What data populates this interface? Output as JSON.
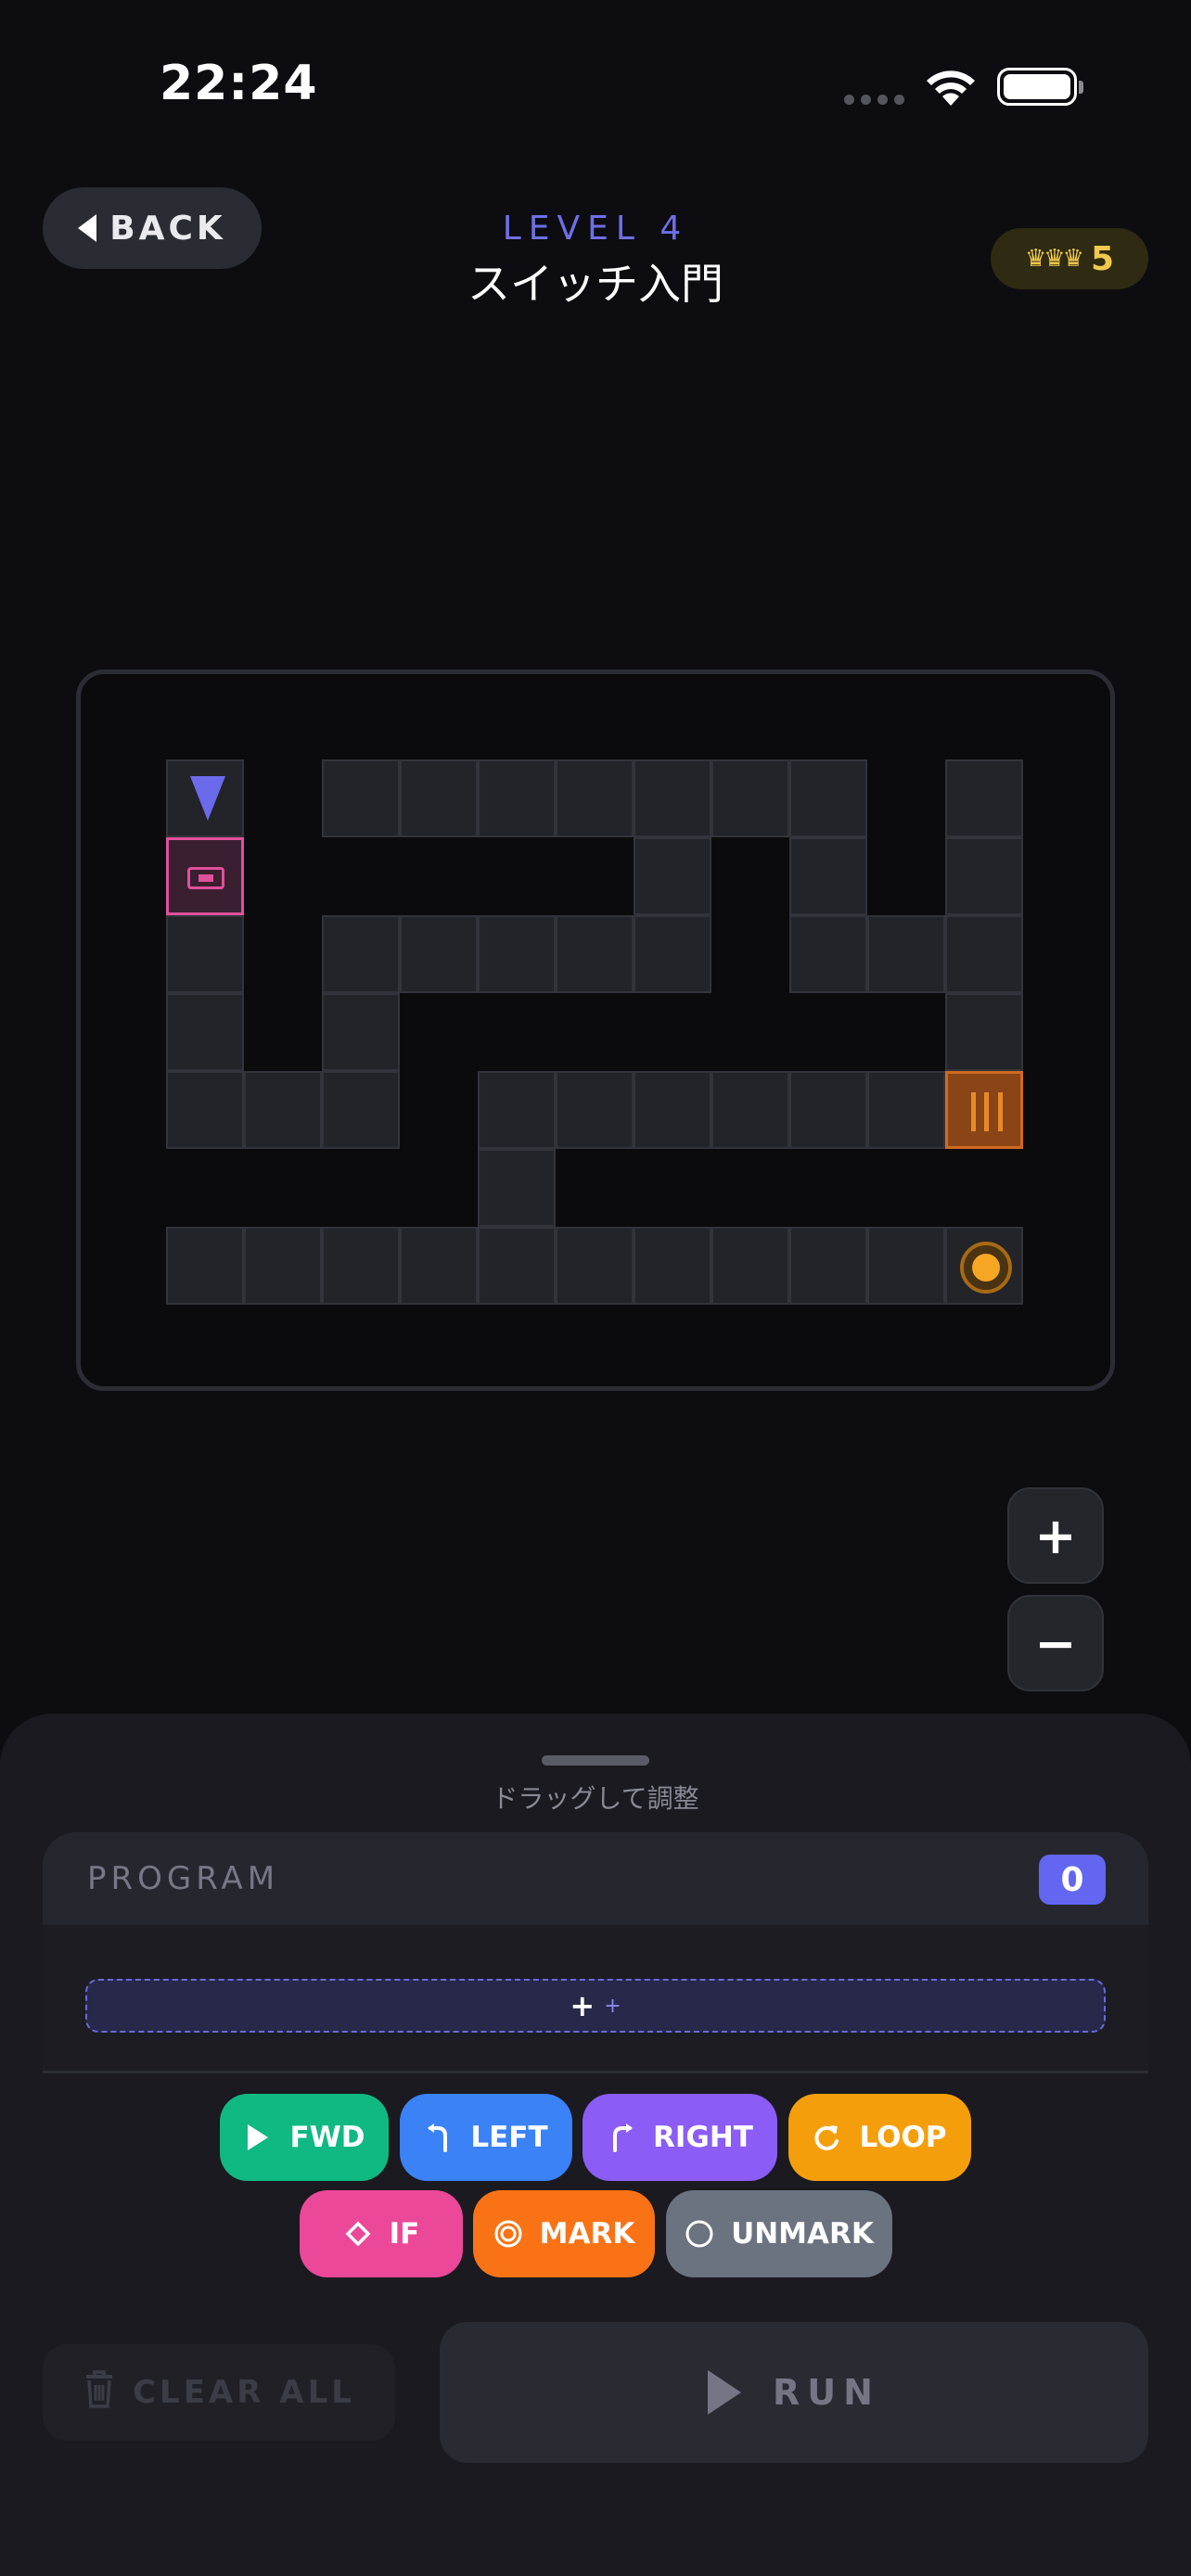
{
  "status_bar": {
    "time": "22:24"
  },
  "header": {
    "back_label": "BACK",
    "level_label": "LEVEL 4",
    "level_title": "スイッチ入門",
    "stars_icons": "♛♛♛",
    "stars_count": "5"
  },
  "board": {
    "robot_direction": "down",
    "zoom_in_label": "+",
    "zoom_out_label": "−"
  },
  "sheet": {
    "drag_hint": "ドラッグして調整",
    "program_label": "PROGRAM",
    "program_count": "0",
    "add_slot_plus": "+",
    "add_slot_plus_small": "+"
  },
  "commands": [
    {
      "label": "FWD",
      "icon": "play-icon",
      "color": "#10b981"
    },
    {
      "label": "LEFT",
      "icon": "turn-left-icon",
      "color": "#3b82f6"
    },
    {
      "label": "RIGHT",
      "icon": "turn-right-icon",
      "color": "#8b5cf6"
    },
    {
      "label": "LOOP",
      "icon": "loop-icon",
      "color": "#f59e0b"
    },
    {
      "label": "IF",
      "icon": "diamond-icon",
      "color": "#ec4899"
    },
    {
      "label": "MARK",
      "icon": "mark-icon",
      "color": "#f97316"
    },
    {
      "label": "UNMARK",
      "icon": "circle-icon",
      "color": "#6b7280"
    }
  ],
  "actions": {
    "clear_label": "CLEAR ALL",
    "run_label": "RUN"
  }
}
